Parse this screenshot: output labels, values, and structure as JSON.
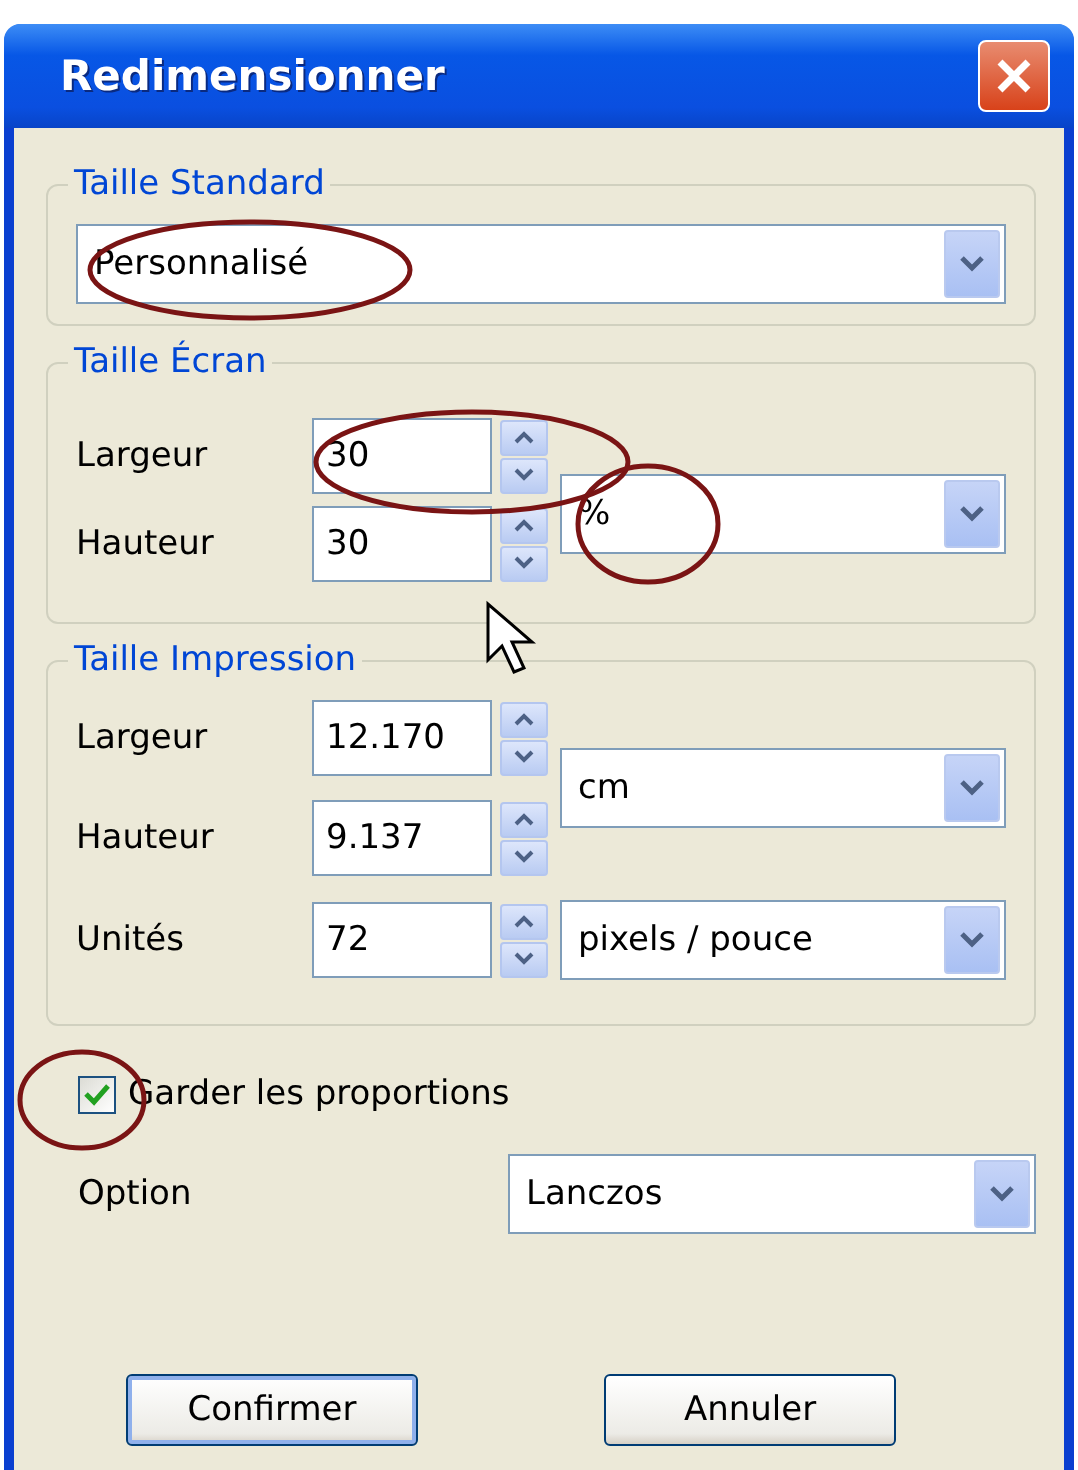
{
  "window": {
    "title": "Redimensionner"
  },
  "standard_size": {
    "title": "Taille Standard",
    "dropdown": {
      "value": "Personnalisé"
    }
  },
  "screen_size": {
    "title": "Taille Écran",
    "rows": [
      {
        "label": "Largeur",
        "value": "30"
      },
      {
        "label": "Hauteur",
        "value": "30"
      }
    ],
    "unit": "%"
  },
  "print_size": {
    "title": "Taille Impression",
    "rows": [
      {
        "label": "Largeur",
        "value": "12.170"
      },
      {
        "label": "Hauteur",
        "value": "9.137"
      }
    ],
    "unit": "cm",
    "resolution": {
      "label": "Unités",
      "value": "72",
      "unit": "pixels / pouce"
    }
  },
  "keep_proportions": {
    "label": "Garder les proportions",
    "checked": true
  },
  "option": {
    "label": "Option",
    "value": "Lanczos"
  },
  "buttons": [
    {
      "label": "Confirmer",
      "default": true
    },
    {
      "label": "Annuler",
      "default": false
    }
  ]
}
